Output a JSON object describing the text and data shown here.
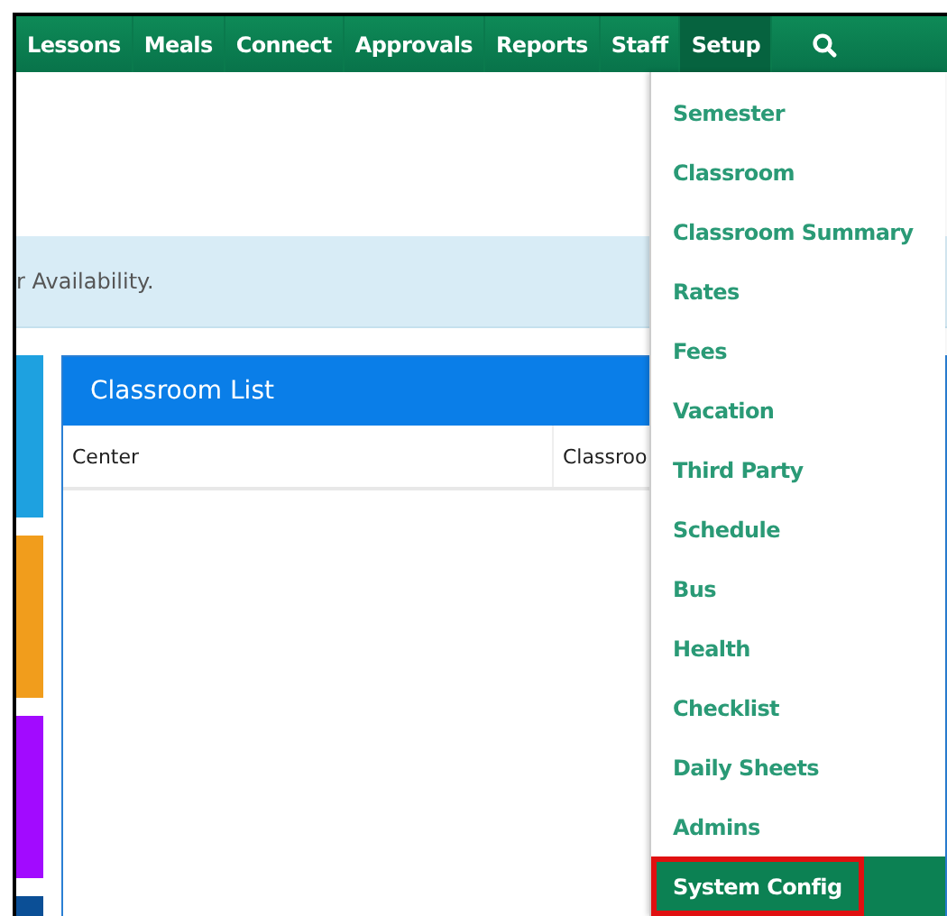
{
  "nav": {
    "items": [
      {
        "label": "Lessons",
        "selected": false
      },
      {
        "label": "Meals",
        "selected": false
      },
      {
        "label": "Connect",
        "selected": false
      },
      {
        "label": "Approvals",
        "selected": false
      },
      {
        "label": "Reports",
        "selected": false
      },
      {
        "label": "Staff",
        "selected": false
      },
      {
        "label": "Setup",
        "selected": true
      }
    ]
  },
  "alert": {
    "text": "r Availability."
  },
  "tiles": [
    {
      "color": "#1ea1e0"
    },
    {
      "color": "#f19d1c"
    },
    {
      "color": "#a20aff"
    },
    {
      "color": "#0b4f96"
    }
  ],
  "panel": {
    "title": "Classroom List",
    "columns": [
      "Center",
      "Classroo"
    ]
  },
  "dropdown": {
    "items": [
      {
        "label": "Semester",
        "selected": false,
        "highlighted": false
      },
      {
        "label": "Classroom",
        "selected": false,
        "highlighted": false
      },
      {
        "label": "Classroom Summary",
        "selected": false,
        "highlighted": false
      },
      {
        "label": "Rates",
        "selected": false,
        "highlighted": false
      },
      {
        "label": "Fees",
        "selected": false,
        "highlighted": false
      },
      {
        "label": "Vacation",
        "selected": false,
        "highlighted": false
      },
      {
        "label": "Third Party",
        "selected": false,
        "highlighted": false
      },
      {
        "label": "Schedule",
        "selected": false,
        "highlighted": false
      },
      {
        "label": "Bus",
        "selected": false,
        "highlighted": false
      },
      {
        "label": "Health",
        "selected": false,
        "highlighted": false
      },
      {
        "label": "Checklist",
        "selected": false,
        "highlighted": false
      },
      {
        "label": "Daily Sheets",
        "selected": false,
        "highlighted": false
      },
      {
        "label": "Admins",
        "selected": false,
        "highlighted": false
      },
      {
        "label": "System Config",
        "selected": true,
        "highlighted": true
      }
    ]
  }
}
